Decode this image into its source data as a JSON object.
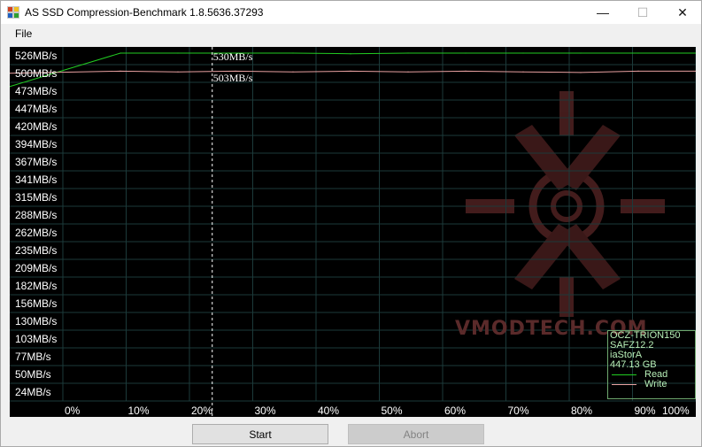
{
  "window": {
    "title": "AS SSD Compression-Benchmark 1.8.5636.37293",
    "controls": {
      "minimize": "—",
      "maximize": "☐",
      "close": "✕"
    }
  },
  "menu": {
    "file": "File"
  },
  "graph": {
    "y_labels": [
      "526MB/s",
      "500MB/s",
      "473MB/s",
      "447MB/s",
      "420MB/s",
      "394MB/s",
      "367MB/s",
      "341MB/s",
      "315MB/s",
      "288MB/s",
      "262MB/s",
      "235MB/s",
      "209MB/s",
      "182MB/s",
      "156MB/s",
      "130MB/s",
      "103MB/s",
      "77MB/s",
      "50MB/s",
      "24MB/s"
    ],
    "x_labels": [
      "0%",
      "10%",
      "20%",
      "30%",
      "40%",
      "50%",
      "60%",
      "70%",
      "80%",
      "90%",
      "100%"
    ],
    "cursor_percent": 25,
    "read_peak_label": "530MB/s",
    "write_peak_label": "503MB/s",
    "read_color": "#22cc22",
    "write_color": "#e8a0a0",
    "read_series_mbps": [
      480,
      530,
      530,
      530,
      530,
      529,
      530,
      530,
      530,
      530,
      530,
      530
    ],
    "write_series_mbps": [
      500,
      503,
      502,
      503,
      502,
      503,
      502,
      503,
      502,
      501,
      503,
      503
    ]
  },
  "watermark": "VMODTECH.COM",
  "info": {
    "drive": "OCZ-TRION150",
    "firmware": "SAFZ12.2",
    "driver": "iaStorA",
    "capacity": "447.13 GB",
    "legend_read": "Read",
    "legend_write": "Write"
  },
  "buttons": {
    "start": "Start",
    "abort": "Abort"
  }
}
